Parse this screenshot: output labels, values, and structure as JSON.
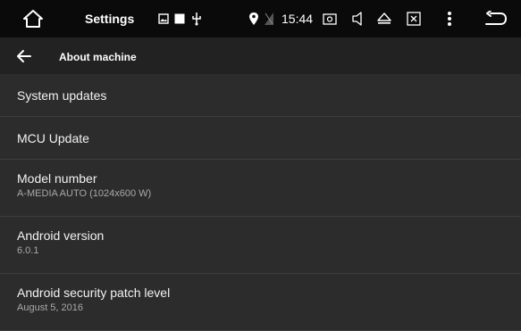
{
  "statusbar": {
    "home_icon": "home-icon",
    "title": "Settings",
    "notif_icons": [
      "image-icon",
      "square-icon",
      "usb-icon"
    ],
    "location_icon": "location-icon",
    "no-sim_icon": "no-sim-icon",
    "time": "15:44",
    "action_icons": [
      "screenshot-icon",
      "volume-icon",
      "eject-icon",
      "close-box-icon",
      "more-vert-icon",
      "back-icon"
    ]
  },
  "appbar": {
    "title": "About machine"
  },
  "items": [
    {
      "title": "System updates"
    },
    {
      "title": "MCU Update"
    },
    {
      "title": "Model number",
      "subtitle": "A-MEDIA AUTO (1024x600 W)"
    },
    {
      "title": "Android version",
      "subtitle": "6.0.1"
    },
    {
      "title": "Android security patch level",
      "subtitle": "August 5, 2016"
    }
  ]
}
